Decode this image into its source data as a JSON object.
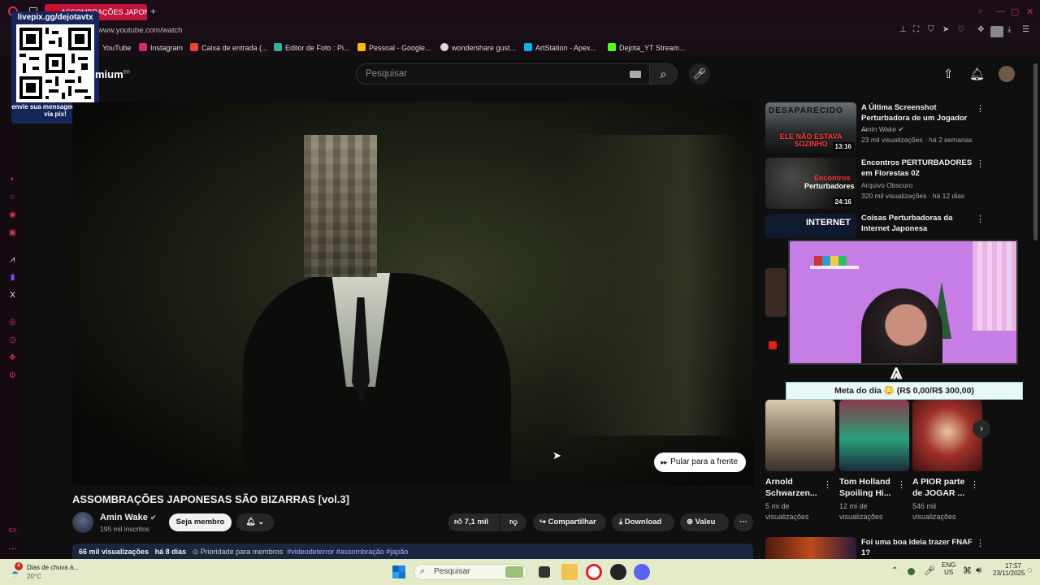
{
  "browser": {
    "tab_title": "ASSOMBRAÇÕES JAPONE",
    "url": "www.youtube.com/watch",
    "bookmarks": [
      {
        "label": "YouTube",
        "color": "#e02020"
      },
      {
        "label": "Instagram",
        "color": "#d62976"
      },
      {
        "label": "Caixa de entrada (...",
        "color": "#ea4335"
      },
      {
        "label": "Editor de Foto : Pi...",
        "color": "#2bb3a0"
      },
      {
        "label": "Pessoal - Google...",
        "color": "#fbbc04"
      },
      {
        "label": "wondershare gust...",
        "color": "#dddddd"
      },
      {
        "label": "ArtStation - Apex...",
        "color": "#13aff0"
      },
      {
        "label": "Dejota_YT Stream...",
        "color": "#53fc18"
      }
    ]
  },
  "overlay": {
    "qr_url": "livepix.gg/dejotavtx",
    "qr_caption": "envie sua mensagem na live via pix!"
  },
  "yt": {
    "logo_text": "mium",
    "logo_sup": "BR",
    "search_placeholder": "Pesquisar"
  },
  "video": {
    "skip_label": "Pular para a frente",
    "title": "ASSOMBRAÇÕES JAPONESAS SÃO BIZARRAS [vol.3]",
    "channel": "Amin Wake",
    "subscribers": "195 mil inscritos",
    "join_label": "Seja membro",
    "likes": "7,1 mil",
    "share_label": "Compartilhar",
    "download_label": "Download",
    "thanks_label": "Valeu",
    "views": "66 mil visualizações",
    "age": "há 8 dias",
    "desc_rest": "⊙ Prioridade para membros",
    "tags": "#videodeterror #assombração #japão"
  },
  "related": [
    {
      "title": "A Última Screenshot Perturbadora de um Jogador ...",
      "channel": "Amin Wake",
      "verified": true,
      "meta": "23 mil visualizações · há 2 semanas",
      "duration": "13:16",
      "thumb_text": "ELE NÃO ESTAVA SOZINHO",
      "thumb_top": "DESAPARECIDO"
    },
    {
      "title": "Encontros PERTURBADORES em Florestas 02",
      "channel": "Arquivo Obscuro",
      "verified": false,
      "meta": "320 mil visualizações · há 12 dias",
      "duration": "24:16",
      "thumb_text": "Perturbadores",
      "thumb_top": "Encontros"
    },
    {
      "title": "Coisas Perturbadoras da Internet Japonesa",
      "thumb_text": "INTERNET"
    },
    {
      "title": "Foi uma boa ideia trazer FNAF 1?"
    }
  ],
  "stream": {
    "goal_label": "Meta do dia",
    "goal_emoji": "😳",
    "goal_value": "(R$ 0,00/R$ 300,00)"
  },
  "shorts": [
    {
      "title": "Arnold Schwarzen...",
      "views": "5 mi de",
      "views2": "visualizações"
    },
    {
      "title": "Tom Holland Spoiling Hi...",
      "views": "12 mi de",
      "views2": "visualizações"
    },
    {
      "title": "A PIOR parte de JOGAR ...",
      "views": "546 mil",
      "views2": "visualizações"
    }
  ],
  "taskbar": {
    "weather_title": "Dias de chuva à...",
    "weather_temp": "20°C",
    "search_placeholder": "Pesquisar",
    "lang": "ENG",
    "region": "US",
    "time": "17:57",
    "date": "23/11/2025",
    "notif_count": "4"
  }
}
